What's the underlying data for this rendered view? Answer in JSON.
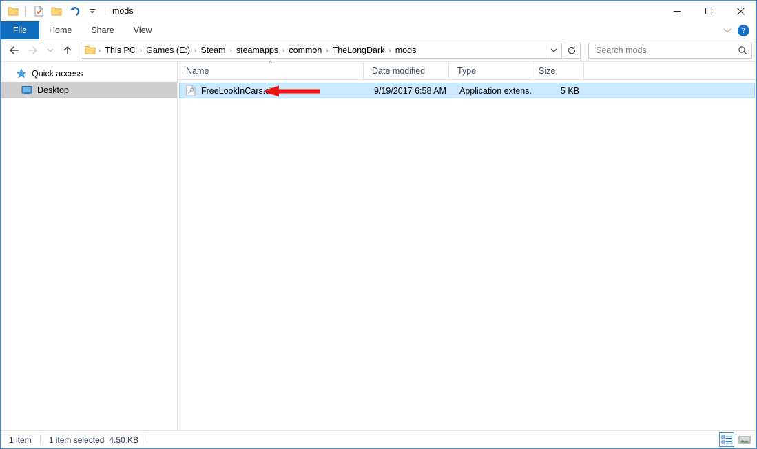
{
  "window": {
    "title": "mods",
    "quick_access_toolbar": [
      {
        "name": "folder-icon",
        "label": "Folder"
      },
      {
        "name": "properties-icon",
        "label": "Properties"
      },
      {
        "name": "new-folder-icon",
        "label": "New folder"
      },
      {
        "name": "undo-icon",
        "label": "Undo"
      },
      {
        "name": "customize-chevron-icon",
        "label": "Customize Quick Access Toolbar"
      }
    ],
    "controls": {
      "minimize": "Minimize",
      "maximize": "Maximize",
      "close": "Close"
    }
  },
  "ribbon": {
    "tabs": [
      {
        "label": "File",
        "active": true
      },
      {
        "label": "Home",
        "active": false
      },
      {
        "label": "Share",
        "active": false
      },
      {
        "label": "View",
        "active": false
      }
    ],
    "collapse_label": "Minimize the Ribbon",
    "help_label": "?"
  },
  "navigation": {
    "back_label": "Back",
    "forward_label": "Forward",
    "recent_label": "Recent locations",
    "up_label": "Up",
    "refresh_label": "Refresh"
  },
  "breadcrumb": {
    "items": [
      "This PC",
      "Games (E:)",
      "Steam",
      "steamapps",
      "common",
      "TheLongDark",
      "mods"
    ],
    "separator": "›",
    "dropdown_label": "Previous locations"
  },
  "search": {
    "placeholder": "Search mods",
    "value": "",
    "icon": "search-icon"
  },
  "sidebar": {
    "items": [
      {
        "label": "Quick access",
        "icon": "star-icon",
        "selected": false,
        "indent": false
      },
      {
        "label": "Desktop",
        "icon": "monitor-icon",
        "selected": true,
        "indent": true
      }
    ]
  },
  "file_list": {
    "columns": [
      {
        "label": "Name",
        "sorted": "asc",
        "sort_glyph": "˄"
      },
      {
        "label": "Date modified",
        "sorted": ""
      },
      {
        "label": "Type",
        "sorted": ""
      },
      {
        "label": "Size",
        "sorted": ""
      }
    ],
    "rows": [
      {
        "name": "FreeLookInCars.dll",
        "date_modified": "9/19/2017 6:58 AM",
        "type": "Application extens...",
        "size": "5 KB",
        "icon": "dll-file-icon",
        "selected": true
      }
    ]
  },
  "annotation": {
    "type": "red-arrow-left",
    "color": "#ee1111"
  },
  "status_bar": {
    "item_count": "1 item",
    "selection": "1 item selected",
    "selection_size": "4.50 KB",
    "views": [
      {
        "name": "details-view-button",
        "label": "Details view",
        "active": true
      },
      {
        "name": "large-icons-view-button",
        "label": "Large icons view",
        "active": false
      }
    ]
  },
  "colors": {
    "accent": "#0f6cbd",
    "selection": "#cce8ff",
    "selection_border": "#99d1ff",
    "sidebar_selected": "#cfcfcf",
    "annotation_red": "#ee1111"
  }
}
